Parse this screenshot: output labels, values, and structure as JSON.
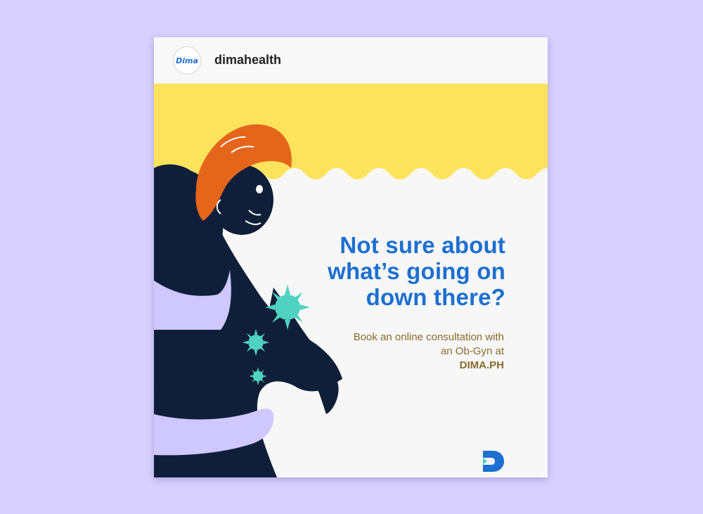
{
  "post": {
    "avatar_text": "Dima",
    "username": "dimahealth"
  },
  "artwork": {
    "headline": [
      "Not sure about",
      "what’s going on",
      "down there?"
    ],
    "subline_line1": "Book an online consultation with",
    "subline_line2_prefix": "an Ob-Gyn at ",
    "subline_link": "DIMA.PH",
    "colors": {
      "background": "#d8d1ff",
      "wave": "#fce35b",
      "headline": "#1d6fd1",
      "subline": "#8a6a2c",
      "hair": "#e5651b",
      "skin": "#0f1f3a",
      "clothes": "#cfc7ff",
      "germs": "#4fd3c0"
    },
    "icons": [
      "avatar-logo",
      "dima-d-logo-icon",
      "germ-icon"
    ]
  }
}
